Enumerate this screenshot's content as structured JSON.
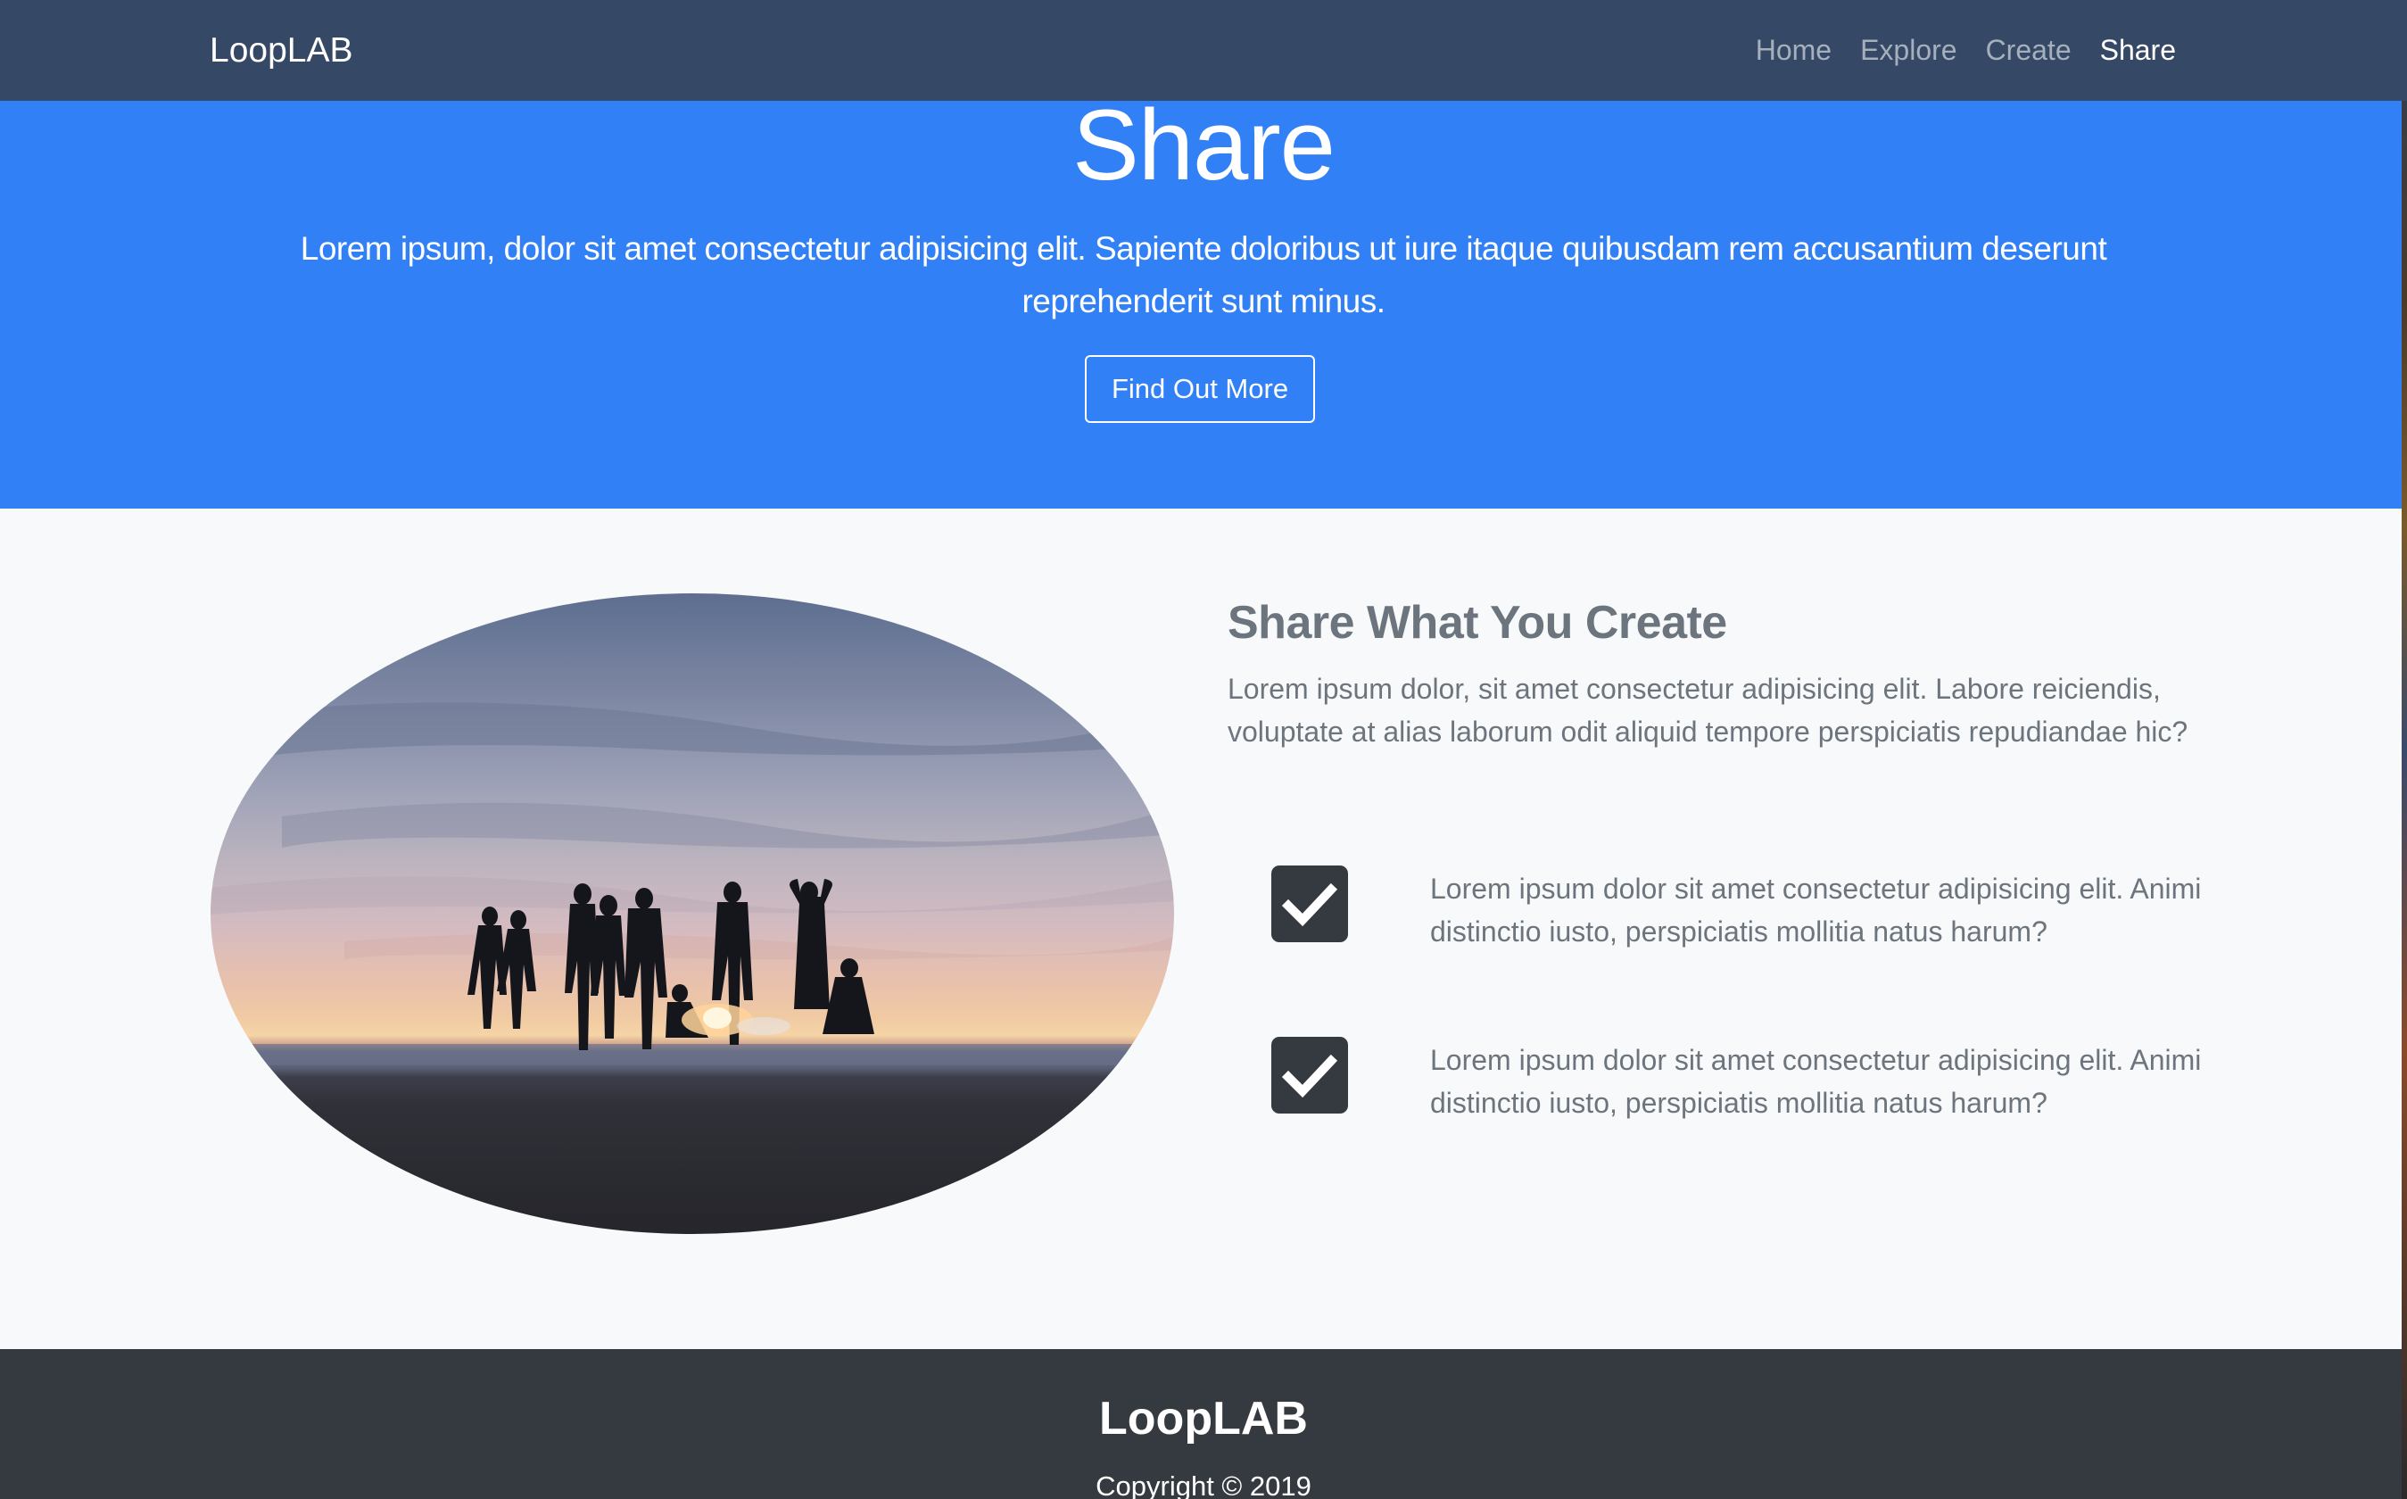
{
  "navbar": {
    "brand": "LoopLAB",
    "links": [
      {
        "label": "Home"
      },
      {
        "label": "Explore"
      },
      {
        "label": "Create"
      },
      {
        "label": "Share"
      }
    ]
  },
  "hero": {
    "title": "Share",
    "text": "Lorem ipsum, dolor sit amet consectetur adipisicing elit. Sapiente doloribus ut iure itaque quibusdam rem accusantium deserunt reprehenderit sunt minus.",
    "button_label": "Find Out More"
  },
  "feature": {
    "title": "Share What You Create",
    "text": "Lorem ipsum dolor, sit amet consectetur adipisicing elit. Labore reiciendis, voluptate at alias laborum odit aliquid tempore perspiciatis repudiandae hic?",
    "items": [
      {
        "text": "Lorem ipsum dolor sit amet consectetur adipisicing elit. Animi distinctio iusto, perspiciatis mollitia natus harum?",
        "icon": "check-square-icon"
      },
      {
        "text": "Lorem ipsum dolor sit amet consectetur adipisicing elit. Animi distinctio iusto, perspiciatis mollitia natus harum?",
        "icon": "check-square-icon"
      }
    ]
  },
  "footer": {
    "brand": "LoopLAB",
    "copyright": "Copyright © 2019"
  },
  "colors": {
    "navbar": "#354865",
    "hero": "#3180f6",
    "footer": "#343a40",
    "muted_text": "#6c757d"
  }
}
